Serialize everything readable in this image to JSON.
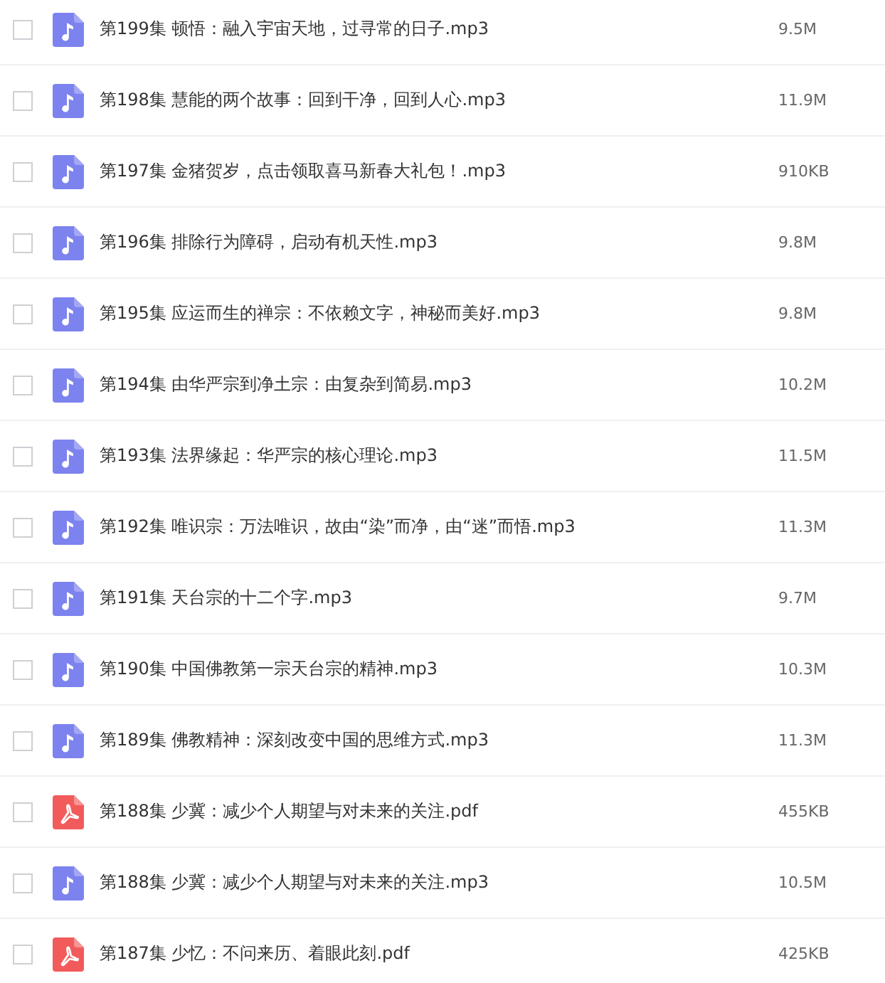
{
  "files": [
    {
      "name": "第199集 顿悟：融入宇宙天地，过寻常的日子.mp3",
      "size": "9.5M",
      "kind": "audio",
      "checked": false
    },
    {
      "name": "第198集 慧能的两个故事：回到干净，回到人心.mp3",
      "size": "11.9M",
      "kind": "audio",
      "checked": false
    },
    {
      "name": "第197集 金猪贺岁，点击领取喜马新春大礼包！.mp3",
      "size": "910KB",
      "kind": "audio",
      "checked": false
    },
    {
      "name": "第196集 排除行为障碍，启动有机天性.mp3",
      "size": "9.8M",
      "kind": "audio",
      "checked": false
    },
    {
      "name": "第195集 应运而生的禅宗：不依赖文字，神秘而美好.mp3",
      "size": "9.8M",
      "kind": "audio",
      "checked": false
    },
    {
      "name": "第194集 由华严宗到净土宗：由复杂到简易.mp3",
      "size": "10.2M",
      "kind": "audio",
      "checked": false
    },
    {
      "name": "第193集 法界缘起：华严宗的核心理论.mp3",
      "size": "11.5M",
      "kind": "audio",
      "checked": false
    },
    {
      "name": "第192集 唯识宗：万法唯识，故由“染”而净，由“迷”而悟.mp3",
      "size": "11.3M",
      "kind": "audio",
      "checked": false
    },
    {
      "name": "第191集 天台宗的十二个字.mp3",
      "size": "9.7M",
      "kind": "audio",
      "checked": false
    },
    {
      "name": "第190集 中国佛教第一宗天台宗的精神.mp3",
      "size": "10.3M",
      "kind": "audio",
      "checked": false
    },
    {
      "name": "第189集 佛教精神：深刻改变中国的思维方式.mp3",
      "size": "11.3M",
      "kind": "audio",
      "checked": false
    },
    {
      "name": "第188集 少冀：减少个人期望与对未来的关注.pdf",
      "size": "455KB",
      "kind": "pdf",
      "checked": false
    },
    {
      "name": "第188集 少冀：减少个人期望与对未来的关注.mp3",
      "size": "10.5M",
      "kind": "audio",
      "checked": false
    },
    {
      "name": "第187集 少忆：不问来历、着眼此刻.pdf",
      "size": "425KB",
      "kind": "pdf",
      "checked": false
    }
  ]
}
